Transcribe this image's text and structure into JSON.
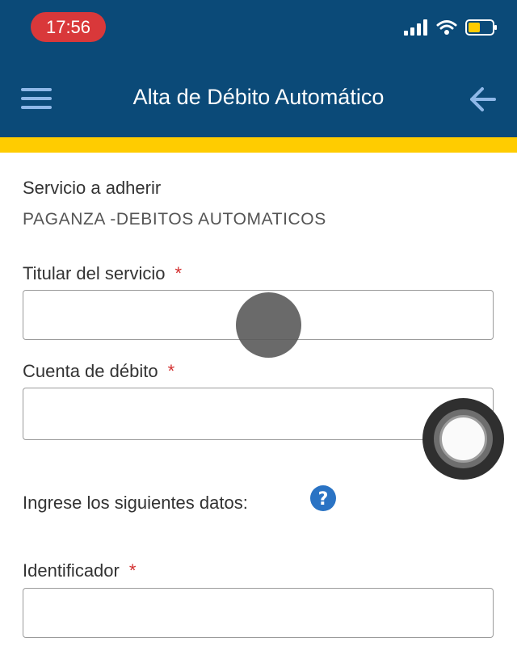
{
  "status_bar": {
    "time": "17:56",
    "icons": [
      "cellular-signal-icon",
      "wifi-icon",
      "battery-icon"
    ],
    "colors": {
      "time_pill": "#d9383a",
      "battery_level": "#ffcc00"
    }
  },
  "header": {
    "title": "Alta de Débito Automático",
    "menu_icon": "hamburger-menu-icon",
    "back_icon": "arrow-left-icon",
    "colors": {
      "background": "#0b4a78",
      "accent": "#ffcc00",
      "back_icon": "#8fb8e8"
    }
  },
  "form": {
    "service_label": "Servicio a adherir",
    "service_value": "PAGANZA -DEBITOS AUTOMATICOS",
    "holder_label": "Titular del servicio",
    "holder_value": "",
    "account_label": "Cuenta de débito",
    "account_value": "",
    "instructions": "Ingrese los siguientes datos:",
    "help_icon": "question-circle-icon",
    "identifier_label": "Identificador",
    "identifier_value": "",
    "required_mark": "*",
    "colors": {
      "required": "#d32f2f",
      "help_icon": "#2a73c4"
    }
  }
}
